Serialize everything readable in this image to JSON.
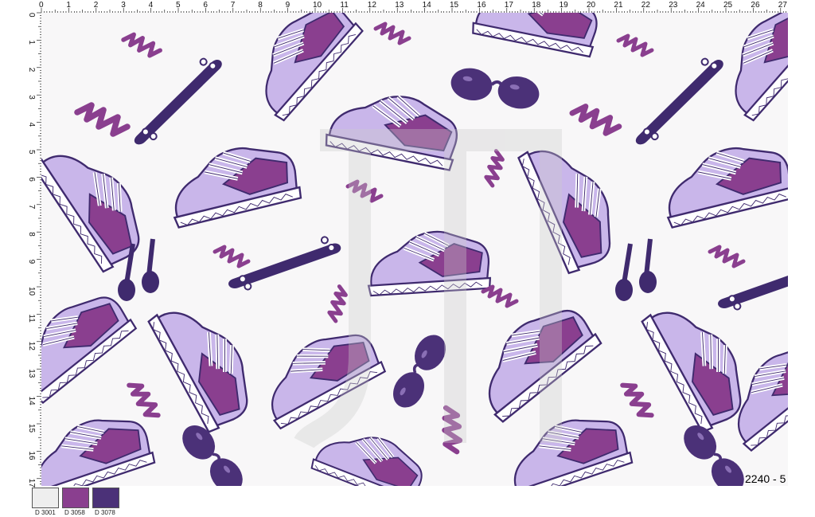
{
  "ruler": {
    "top_labels": [
      "0",
      "1",
      "2",
      "3",
      "4",
      "5",
      "6",
      "7",
      "8",
      "9",
      "10",
      "11",
      "12",
      "13",
      "14",
      "15",
      "16",
      "17",
      "18",
      "19",
      "20",
      "21",
      "22",
      "23",
      "24",
      "25",
      "26",
      "27"
    ],
    "left_labels": [
      "0",
      "1",
      "2",
      "3",
      "4",
      "5",
      "6",
      "7",
      "8",
      "9",
      "10",
      "11",
      "12",
      "13",
      "14",
      "15",
      "16",
      "17"
    ]
  },
  "pattern": {
    "background": "#f8f7f8",
    "motifs": [
      "sneaker-icon",
      "skateboard-icon",
      "sunglasses-icon",
      "earphones-icon",
      "squiggle-icon"
    ],
    "outline_color": "#3f2a6e"
  },
  "swatches": [
    {
      "label": "D 3001",
      "color": "#eeeeee"
    },
    {
      "label": "D 3058",
      "color": "#8a3f8f"
    },
    {
      "label": "D 3078",
      "color": "#4b3178"
    }
  ],
  "design_code": "2240 - 5"
}
